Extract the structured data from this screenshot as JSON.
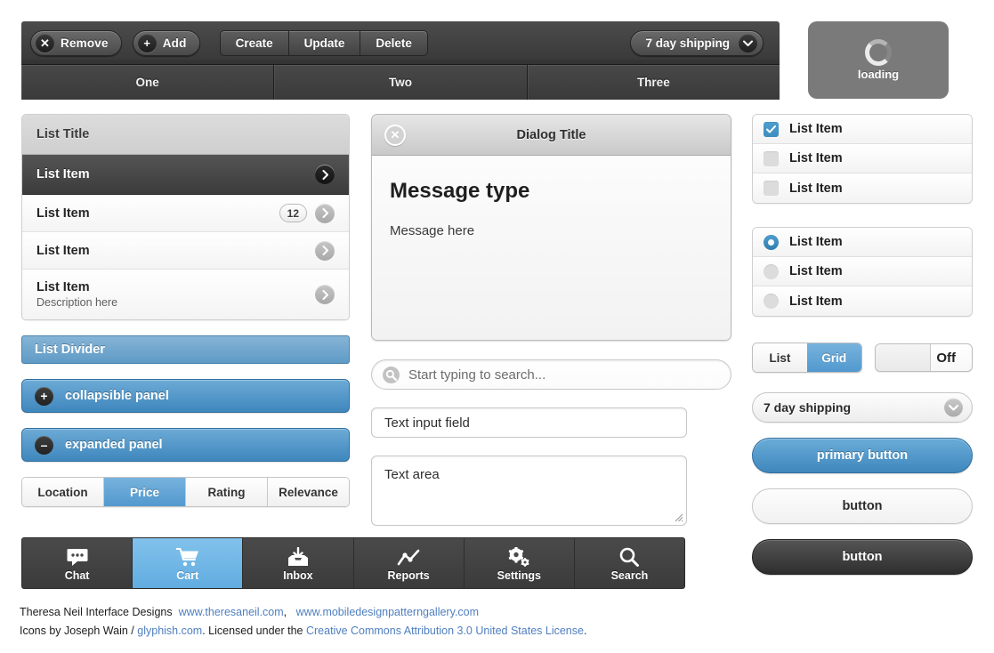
{
  "toolbar": {
    "remove_label": "Remove",
    "remove_glyph": "✕",
    "add_label": "Add",
    "add_glyph": "+",
    "segments": [
      "Create",
      "Update",
      "Delete"
    ],
    "dropdown_value": "7 day shipping"
  },
  "tabs": [
    "One",
    "Two",
    "Three"
  ],
  "loading": {
    "label": "loading"
  },
  "list_panel": {
    "title": "List Title",
    "items": [
      {
        "label": "List Item",
        "selected": true,
        "badge": null,
        "desc": null
      },
      {
        "label": "List Item",
        "selected": false,
        "badge": "12",
        "desc": null
      },
      {
        "label": "List Item",
        "selected": false,
        "badge": null,
        "desc": null
      },
      {
        "label": "List Item",
        "selected": false,
        "badge": null,
        "desc": "Description here"
      }
    ]
  },
  "list_divider": {
    "label": "List Divider"
  },
  "panels": [
    {
      "label": "collapsible panel",
      "glyph": "+"
    },
    {
      "label": "expanded panel",
      "glyph": "–"
    }
  ],
  "filterbar": {
    "options": [
      "Location",
      "Price",
      "Rating",
      "Relevance"
    ],
    "active": "Price"
  },
  "tabbar": {
    "items": [
      {
        "label": "Chat",
        "icon": "chat-icon",
        "active": false
      },
      {
        "label": "Cart",
        "icon": "cart-icon",
        "active": true
      },
      {
        "label": "Inbox",
        "icon": "inbox-icon",
        "active": false
      },
      {
        "label": "Reports",
        "icon": "reports-icon",
        "active": false
      },
      {
        "label": "Settings",
        "icon": "settings-icon",
        "active": false
      },
      {
        "label": "Search",
        "icon": "search-icon",
        "active": false
      }
    ]
  },
  "dialog": {
    "title": "Dialog Title",
    "close_glyph": "✕",
    "heading": "Message type",
    "body": "Message here"
  },
  "forms": {
    "search_placeholder": "Start typing to search...",
    "text_input_value": "Text input field",
    "textarea_value": "Text area"
  },
  "checkbox_list": [
    {
      "label": "List Item",
      "checked": true
    },
    {
      "label": "List Item",
      "checked": false
    },
    {
      "label": "List Item",
      "checked": false
    }
  ],
  "radio_list": [
    {
      "label": "List Item",
      "checked": true
    },
    {
      "label": "List Item",
      "checked": false
    },
    {
      "label": "List Item",
      "checked": false
    }
  ],
  "view_toggle": {
    "options": [
      "List",
      "Grid"
    ],
    "active": "Grid"
  },
  "switch": {
    "label": "Off",
    "state": "off"
  },
  "dropdown_light": {
    "value": "7 day shipping"
  },
  "buttons": {
    "primary": "primary button",
    "plain": "button",
    "dark": "button"
  },
  "footer": {
    "line1_prefix": "Theresa Neil Interface Designs",
    "link1": "www.theresaneil.com",
    "comma": ",",
    "link2": "www.mobiledesignpatterngallery.com",
    "line2_prefix": "Icons by Joseph Wain /",
    "link3": "glyphish.com",
    "line2_mid": ". Licensed under the",
    "link4": "Creative Commons Attribution 3.0 United States License",
    "period": "."
  },
  "colors": {
    "accent_blue": "#3f87bd",
    "light_blue": "#61ace0",
    "dark_chrome": "#3a3a3a"
  }
}
